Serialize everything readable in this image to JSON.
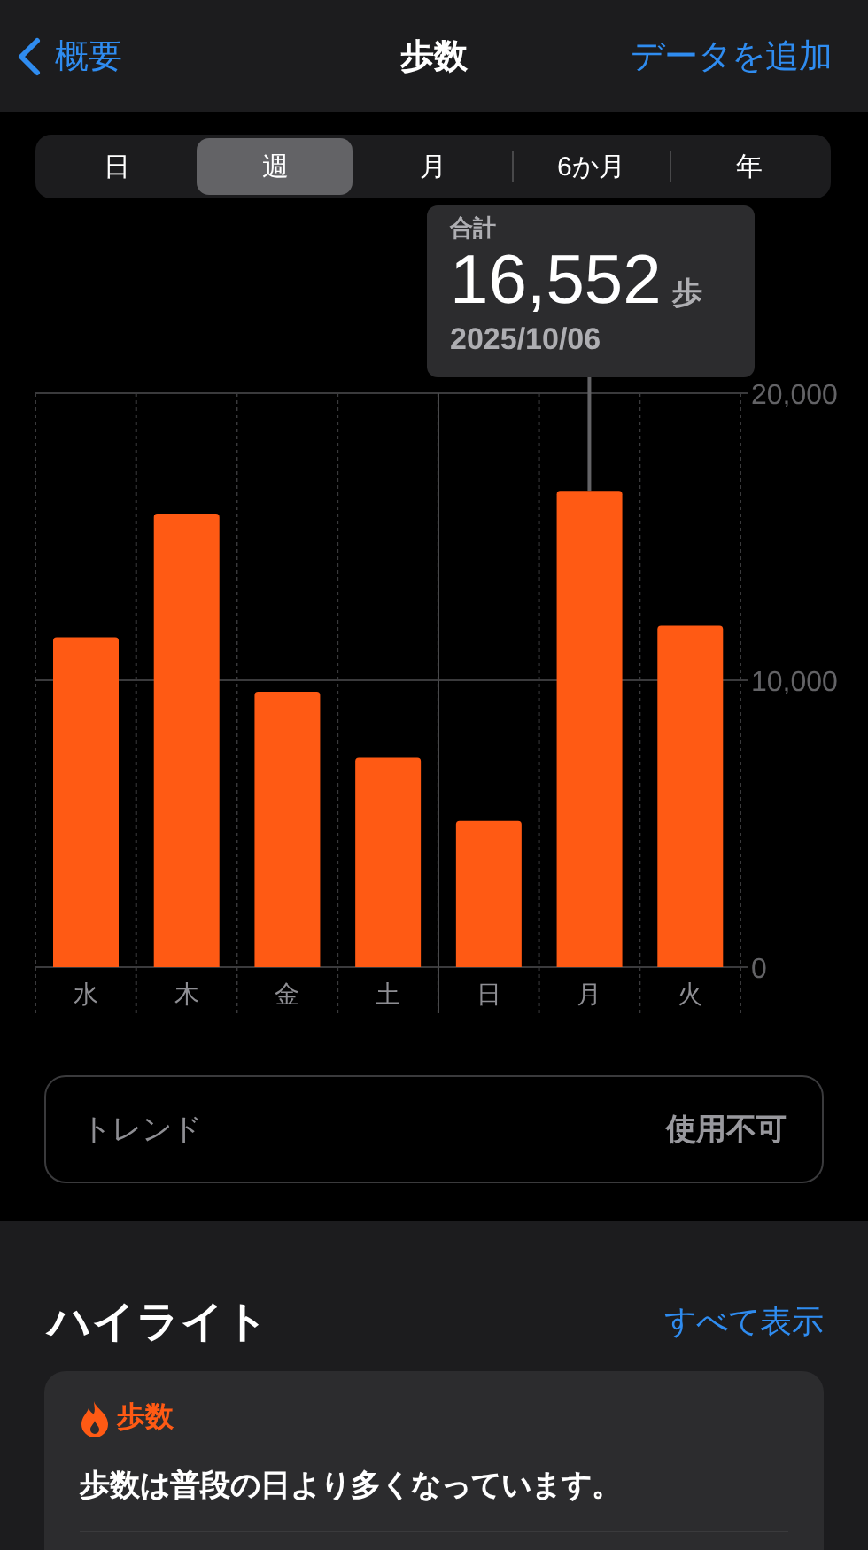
{
  "nav": {
    "back": "概要",
    "title": "歩数",
    "action": "データを追加"
  },
  "periods": [
    {
      "label": "日",
      "selected": false
    },
    {
      "label": "週",
      "selected": true
    },
    {
      "label": "月",
      "selected": false
    },
    {
      "label": "6か月",
      "selected": false
    },
    {
      "label": "年",
      "selected": false
    }
  ],
  "summary": {
    "label": "合計",
    "value": "16,552",
    "unit": "歩",
    "date": "2025/10/06"
  },
  "chart_data": {
    "type": "bar",
    "categories": [
      "水",
      "木",
      "金",
      "土",
      "日",
      "月",
      "火"
    ],
    "series": [
      {
        "color": "#ff5a14",
        "values": [
          11500,
          15800,
          9600,
          7300,
          5100,
          16600,
          11900
        ]
      }
    ],
    "ylim": [
      0,
      20000
    ],
    "yticks": [
      {
        "value": 0,
        "label": "0"
      },
      {
        "value": 10000,
        "label": "10,000"
      },
      {
        "value": 20000,
        "label": "20,000"
      }
    ]
  },
  "trend": {
    "label": "トレンド",
    "value": "使用不可"
  },
  "highlights": {
    "title": "ハイライト",
    "link": "すべて表示",
    "card": {
      "category": "歩数",
      "text": "歩数は普段の日より多くなっています。"
    }
  }
}
